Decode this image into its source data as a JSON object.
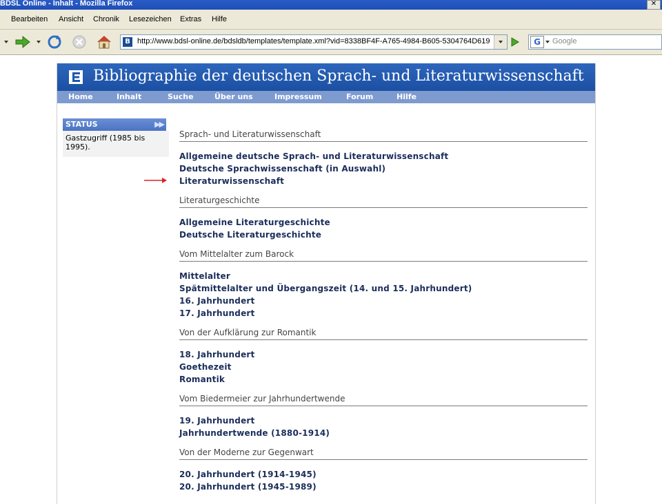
{
  "window": {
    "title": "BDSL Online - Inhalt - Mozilla Firefox"
  },
  "menu": {
    "items": [
      "Bearbeiten",
      "Ansicht",
      "Chronik",
      "Lesezeichen",
      "Extras",
      "Hilfe"
    ]
  },
  "toolbar": {
    "url": "http://www.bdsl-online.de/bdsldb/templates/template.xml?vid=8338BF4F-A765-4984-B605-5304764D619",
    "search_placeholder": "Google",
    "icons": [
      "back-icon",
      "forward-icon",
      "reload-icon",
      "stop-icon",
      "home-icon",
      "go-icon",
      "google-icon"
    ]
  },
  "site": {
    "title": "Bibliographie der deutschen Sprach- und Literaturwissenschaft",
    "logo_letter": "B",
    "nav": [
      "Home",
      "Inhalt",
      "Suche",
      "Über uns",
      "Impressum",
      "Forum",
      "Hilfe"
    ],
    "brand_color": "#1f57ad"
  },
  "status": {
    "heading": "STATUS",
    "text": "Gastzugriff (1985 bis 1995)."
  },
  "sections": [
    {
      "title": "Sprach- und Literaturwissenschaft",
      "links": [
        "Allgemeine deutsche Sprach- und Literaturwissenschaft",
        "Deutsche Sprachwissenschaft (in Auswahl)",
        "Literaturwissenschaft"
      ]
    },
    {
      "title": "Literaturgeschichte",
      "links": [
        "Allgemeine Literaturgeschichte",
        "Deutsche Literaturgeschichte"
      ]
    },
    {
      "title": "Vom Mittelalter zum Barock",
      "links": [
        "Mittelalter",
        "Spätmittelalter und Übergangszeit (14. und 15. Jahrhundert)",
        "16. Jahrhundert",
        "17. Jahrhundert"
      ]
    },
    {
      "title": "Von der Aufklärung zur Romantik",
      "links": [
        "18. Jahrhundert",
        "Goethezeit",
        "Romantik"
      ]
    },
    {
      "title": "Vom Biedermeier zur Jahrhundertwende",
      "links": [
        "19. Jahrhundert",
        "Jahrhundertwende (1880-1914)"
      ]
    },
    {
      "title": "Von der Moderne zur Gegenwart",
      "links": [
        "20. Jahrhundert (1914-1945)",
        "20. Jahrhundert (1945-1989)"
      ]
    }
  ]
}
